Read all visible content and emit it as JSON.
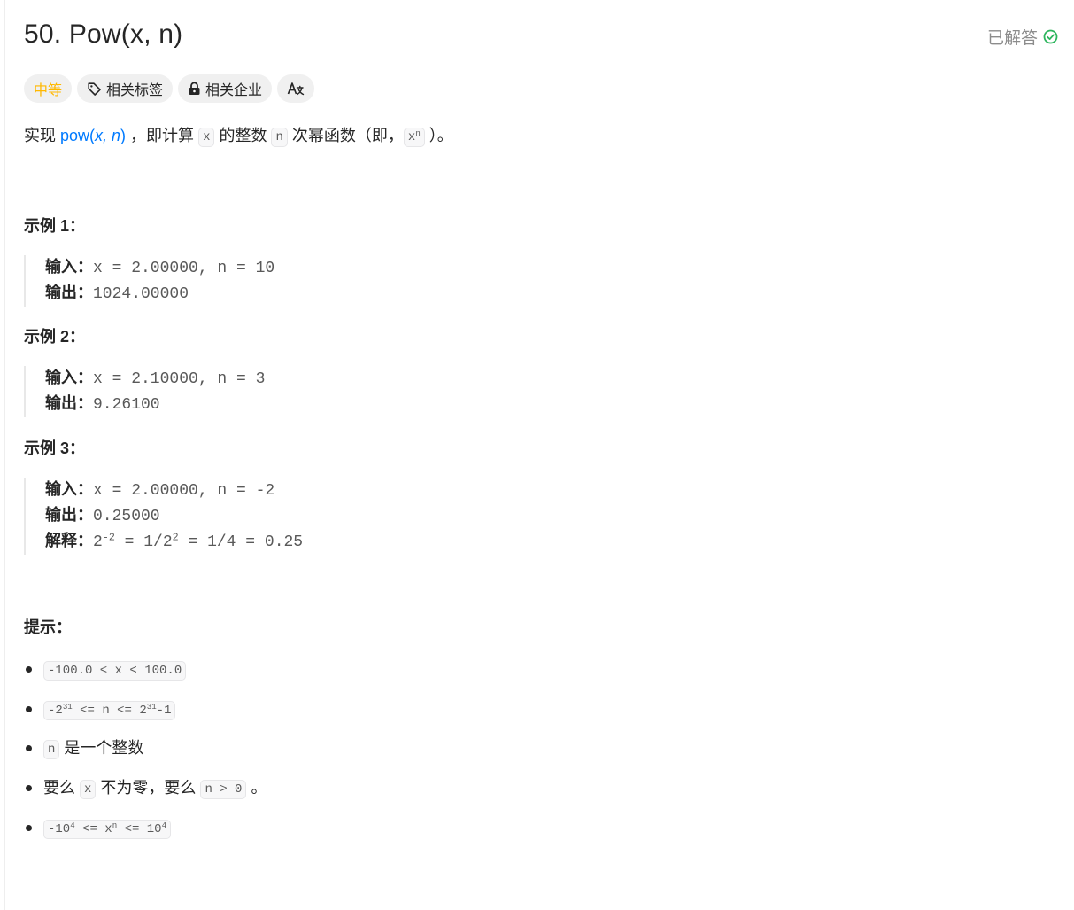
{
  "problem": {
    "title": "50. Pow(x, n)",
    "status_label": "已解答",
    "status_icon": "check-circle-icon",
    "status_color": "#2db55d"
  },
  "tags": {
    "difficulty": "中等",
    "difficulty_color": "#ffb800",
    "topics": "相关标签",
    "companies": "相关企业",
    "translate": "Aあ"
  },
  "description": {
    "part1": "实现 ",
    "link_pre": "pow(",
    "link_args": "x, n",
    "link_post": ")",
    "part2": " ，即计算 ",
    "code_x": "x",
    "part3": " 的整数 ",
    "code_n": "n",
    "part4": " 次幂函数（即，",
    "code_xn_base": "x",
    "code_xn_exp": "n",
    "part5": " ）。"
  },
  "examples": [
    {
      "title": "示例 1：",
      "input_label": "输入：",
      "input": "x = 2.00000, n = 10",
      "output_label": "输出：",
      "output": "1024.00000"
    },
    {
      "title": "示例 2：",
      "input_label": "输入：",
      "input": "x = 2.10000, n = 3",
      "output_label": "输出：",
      "output": "9.26100"
    },
    {
      "title": "示例 3：",
      "input_label": "输入：",
      "input": "x = 2.00000, n = -2",
      "output_label": "输出：",
      "output": "0.25000",
      "explain_label": "解释：",
      "explain_a": "2",
      "explain_a_exp": "-2",
      "explain_b": " = 1/2",
      "explain_b_exp": "2",
      "explain_c": " = 1/4 = 0.25"
    }
  ],
  "hints": {
    "title": "提示：",
    "h1": "-100.0 < x < 100.0",
    "h2_a": "-2",
    "h2_a_exp": "31",
    "h2_b": " <= n <= 2",
    "h2_b_exp": "31",
    "h2_c": "-1",
    "h3_code": "n",
    "h3_text": " 是一个整数",
    "h4_a": "要么 ",
    "h4_code1": "x",
    "h4_b": " 不为零，要么 ",
    "h4_code2": "n > 0",
    "h4_c": " 。",
    "h5_a": "-10",
    "h5_a_exp": "4",
    "h5_b": " <= x",
    "h5_b_exp": "n",
    "h5_c": " <= 10",
    "h5_c_exp": "4"
  }
}
